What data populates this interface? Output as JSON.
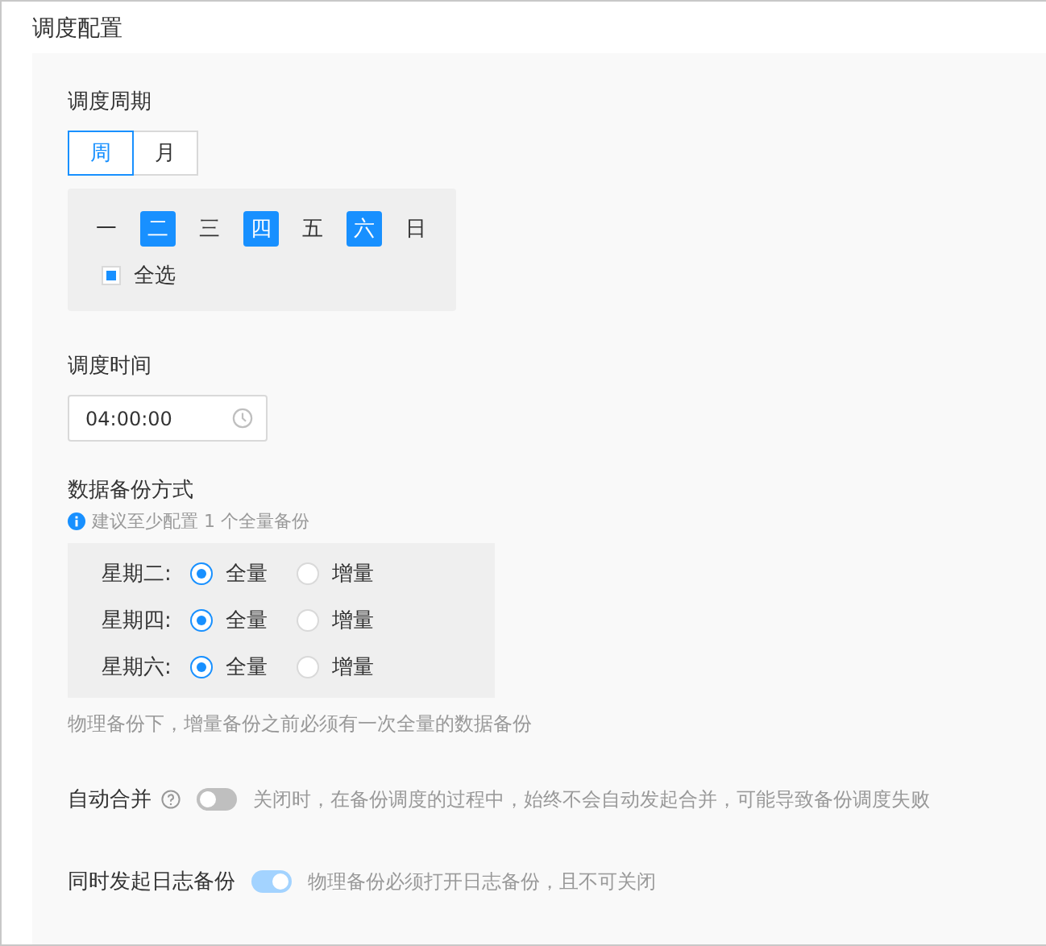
{
  "title": "调度配置",
  "cycle": {
    "label": "调度周期",
    "modes": [
      {
        "label": "周",
        "selected": true
      },
      {
        "label": "月",
        "selected": false
      }
    ],
    "days": [
      {
        "label": "一",
        "selected": false
      },
      {
        "label": "二",
        "selected": true
      },
      {
        "label": "三",
        "selected": false
      },
      {
        "label": "四",
        "selected": true
      },
      {
        "label": "五",
        "selected": false
      },
      {
        "label": "六",
        "selected": true
      },
      {
        "label": "日",
        "selected": false
      }
    ],
    "select_all": {
      "label": "全选",
      "checked": true,
      "partial": true
    }
  },
  "time": {
    "label": "调度时间",
    "value": "04:00:00"
  },
  "backup": {
    "label": "数据备份方式",
    "hint": "建议至少配置 1 个全量备份",
    "rows": [
      {
        "day": "星期二:",
        "options": [
          {
            "label": "全量",
            "selected": true
          },
          {
            "label": "增量",
            "selected": false
          }
        ]
      },
      {
        "day": "星期四:",
        "options": [
          {
            "label": "全量",
            "selected": true
          },
          {
            "label": "增量",
            "selected": false
          }
        ]
      },
      {
        "day": "星期六:",
        "options": [
          {
            "label": "全量",
            "selected": true
          },
          {
            "label": "增量",
            "selected": false
          }
        ]
      }
    ],
    "note": "物理备份下，增量备份之前必须有一次全量的数据备份"
  },
  "switches": [
    {
      "label": "自动合并",
      "help": true,
      "on": false,
      "disabled": false,
      "description": "关闭时，在备份调度的过程中，始终不会自动发起合并，可能导致备份调度失败"
    },
    {
      "label": "同时发起日志备份",
      "help": false,
      "on": true,
      "disabled": true,
      "description": "物理备份必须打开日志备份，且不可关闭"
    }
  ]
}
